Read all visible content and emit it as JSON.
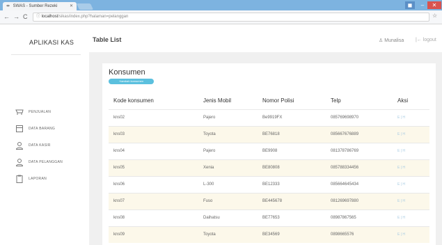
{
  "browser": {
    "tab_title": "SWAS - Sumber Rezeki",
    "url_host": "localhost",
    "url_path": "/sikas/index.php?halaman=pelanggan"
  },
  "sidebar": {
    "brand": "APLIKASI KAS",
    "items": [
      {
        "label": "PENJUALAN",
        "icon": "cart-icon"
      },
      {
        "label": "DATA BARANG",
        "icon": "box-icon"
      },
      {
        "label": "DATA KASIR",
        "icon": "user-icon"
      },
      {
        "label": "DATA PELANGGAN",
        "icon": "user-icon"
      },
      {
        "label": "LAPORAN",
        "icon": "clipboard-icon"
      }
    ]
  },
  "header": {
    "title": "Table List",
    "user": "Munalisa",
    "logout": "logout"
  },
  "card": {
    "title": "Konsumen",
    "add_button": "+tambah konsumen"
  },
  "table": {
    "columns": [
      "Kode konsumen",
      "Jenis Mobil",
      "Nomor Polisi",
      "Telp",
      "Aksi"
    ],
    "rows": [
      {
        "kode": "kns02",
        "jenis": "Pajero",
        "polisi": "Be9919FX",
        "telp": "085769698970",
        "aksi": "E | H"
      },
      {
        "kode": "kns03",
        "jenis": "Toyota",
        "polisi": "BE76818",
        "telp": "085667676889",
        "aksi": "E | H"
      },
      {
        "kode": "kns04",
        "jenis": "Pajero",
        "polisi": "BE9908",
        "telp": "081378786769",
        "aksi": "E | H"
      },
      {
        "kode": "kns05",
        "jenis": "Xenia",
        "polisi": "BE80808",
        "telp": "085788334456",
        "aksi": "E | H"
      },
      {
        "kode": "kns06",
        "jenis": "L-300",
        "polisi": "BE12333",
        "telp": "085664645434",
        "aksi": "E | H"
      },
      {
        "kode": "kns07",
        "jenis": "Fuso",
        "polisi": "BE445678",
        "telp": "081269697880",
        "aksi": "E | H"
      },
      {
        "kode": "kns08",
        "jenis": "Daihatsu",
        "polisi": "BE77653",
        "telp": "08987867565",
        "aksi": "E | H"
      },
      {
        "kode": "kns09",
        "jenis": "Toyota",
        "polisi": "BE34569",
        "telp": "0898665576",
        "aksi": "E | H"
      }
    ]
  }
}
